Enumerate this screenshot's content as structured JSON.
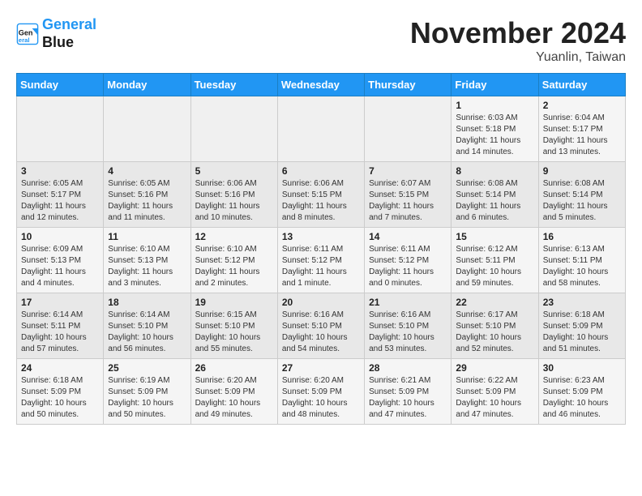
{
  "header": {
    "logo_line1": "General",
    "logo_line2": "Blue",
    "month_title": "November 2024",
    "location": "Yuanlin, Taiwan"
  },
  "weekdays": [
    "Sunday",
    "Monday",
    "Tuesday",
    "Wednesday",
    "Thursday",
    "Friday",
    "Saturday"
  ],
  "weeks": [
    [
      {
        "day": "",
        "info": ""
      },
      {
        "day": "",
        "info": ""
      },
      {
        "day": "",
        "info": ""
      },
      {
        "day": "",
        "info": ""
      },
      {
        "day": "",
        "info": ""
      },
      {
        "day": "1",
        "info": "Sunrise: 6:03 AM\nSunset: 5:18 PM\nDaylight: 11 hours\nand 14 minutes."
      },
      {
        "day": "2",
        "info": "Sunrise: 6:04 AM\nSunset: 5:17 PM\nDaylight: 11 hours\nand 13 minutes."
      }
    ],
    [
      {
        "day": "3",
        "info": "Sunrise: 6:05 AM\nSunset: 5:17 PM\nDaylight: 11 hours\nand 12 minutes."
      },
      {
        "day": "4",
        "info": "Sunrise: 6:05 AM\nSunset: 5:16 PM\nDaylight: 11 hours\nand 11 minutes."
      },
      {
        "day": "5",
        "info": "Sunrise: 6:06 AM\nSunset: 5:16 PM\nDaylight: 11 hours\nand 10 minutes."
      },
      {
        "day": "6",
        "info": "Sunrise: 6:06 AM\nSunset: 5:15 PM\nDaylight: 11 hours\nand 8 minutes."
      },
      {
        "day": "7",
        "info": "Sunrise: 6:07 AM\nSunset: 5:15 PM\nDaylight: 11 hours\nand 7 minutes."
      },
      {
        "day": "8",
        "info": "Sunrise: 6:08 AM\nSunset: 5:14 PM\nDaylight: 11 hours\nand 6 minutes."
      },
      {
        "day": "9",
        "info": "Sunrise: 6:08 AM\nSunset: 5:14 PM\nDaylight: 11 hours\nand 5 minutes."
      }
    ],
    [
      {
        "day": "10",
        "info": "Sunrise: 6:09 AM\nSunset: 5:13 PM\nDaylight: 11 hours\nand 4 minutes."
      },
      {
        "day": "11",
        "info": "Sunrise: 6:10 AM\nSunset: 5:13 PM\nDaylight: 11 hours\nand 3 minutes."
      },
      {
        "day": "12",
        "info": "Sunrise: 6:10 AM\nSunset: 5:12 PM\nDaylight: 11 hours\nand 2 minutes."
      },
      {
        "day": "13",
        "info": "Sunrise: 6:11 AM\nSunset: 5:12 PM\nDaylight: 11 hours\nand 1 minute."
      },
      {
        "day": "14",
        "info": "Sunrise: 6:11 AM\nSunset: 5:12 PM\nDaylight: 11 hours\nand 0 minutes."
      },
      {
        "day": "15",
        "info": "Sunrise: 6:12 AM\nSunset: 5:11 PM\nDaylight: 10 hours\nand 59 minutes."
      },
      {
        "day": "16",
        "info": "Sunrise: 6:13 AM\nSunset: 5:11 PM\nDaylight: 10 hours\nand 58 minutes."
      }
    ],
    [
      {
        "day": "17",
        "info": "Sunrise: 6:14 AM\nSunset: 5:11 PM\nDaylight: 10 hours\nand 57 minutes."
      },
      {
        "day": "18",
        "info": "Sunrise: 6:14 AM\nSunset: 5:10 PM\nDaylight: 10 hours\nand 56 minutes."
      },
      {
        "day": "19",
        "info": "Sunrise: 6:15 AM\nSunset: 5:10 PM\nDaylight: 10 hours\nand 55 minutes."
      },
      {
        "day": "20",
        "info": "Sunrise: 6:16 AM\nSunset: 5:10 PM\nDaylight: 10 hours\nand 54 minutes."
      },
      {
        "day": "21",
        "info": "Sunrise: 6:16 AM\nSunset: 5:10 PM\nDaylight: 10 hours\nand 53 minutes."
      },
      {
        "day": "22",
        "info": "Sunrise: 6:17 AM\nSunset: 5:10 PM\nDaylight: 10 hours\nand 52 minutes."
      },
      {
        "day": "23",
        "info": "Sunrise: 6:18 AM\nSunset: 5:09 PM\nDaylight: 10 hours\nand 51 minutes."
      }
    ],
    [
      {
        "day": "24",
        "info": "Sunrise: 6:18 AM\nSunset: 5:09 PM\nDaylight: 10 hours\nand 50 minutes."
      },
      {
        "day": "25",
        "info": "Sunrise: 6:19 AM\nSunset: 5:09 PM\nDaylight: 10 hours\nand 50 minutes."
      },
      {
        "day": "26",
        "info": "Sunrise: 6:20 AM\nSunset: 5:09 PM\nDaylight: 10 hours\nand 49 minutes."
      },
      {
        "day": "27",
        "info": "Sunrise: 6:20 AM\nSunset: 5:09 PM\nDaylight: 10 hours\nand 48 minutes."
      },
      {
        "day": "28",
        "info": "Sunrise: 6:21 AM\nSunset: 5:09 PM\nDaylight: 10 hours\nand 47 minutes."
      },
      {
        "day": "29",
        "info": "Sunrise: 6:22 AM\nSunset: 5:09 PM\nDaylight: 10 hours\nand 47 minutes."
      },
      {
        "day": "30",
        "info": "Sunrise: 6:23 AM\nSunset: 5:09 PM\nDaylight: 10 hours\nand 46 minutes."
      }
    ]
  ]
}
